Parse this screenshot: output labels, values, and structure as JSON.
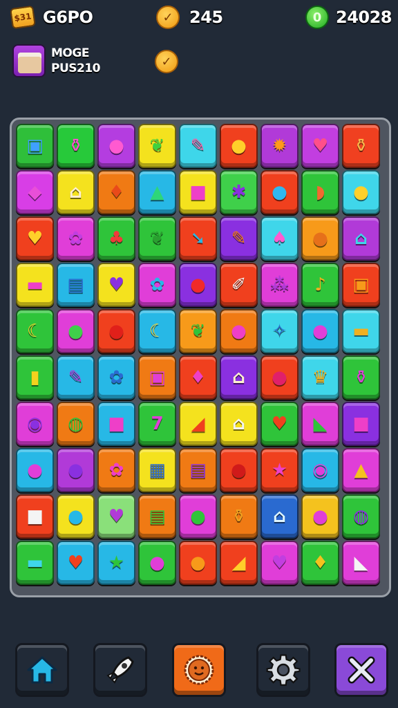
{
  "hud": {
    "level_badge": "$31",
    "title": "G6PO",
    "coins": "245",
    "gems": "24028",
    "profile_line1": "MOGE",
    "profile_line2": "PUS210",
    "coin_glyph": "✓"
  },
  "board": {
    "rows": 10,
    "cols": 9,
    "tiles": [
      [
        {
          "bg": "#2fbf3a",
          "icon": "tablet-icon",
          "g": "▣",
          "c": "#3fa0ff"
        },
        {
          "bg": "#27c93a",
          "icon": "bottle-icon",
          "g": "⚱",
          "c": "#ff4fd0"
        },
        {
          "bg": "#b43de0",
          "icon": "apple-icon",
          "g": "●",
          "c": "#ff5ad0"
        },
        {
          "bg": "#f4e21e",
          "icon": "leaf-icon",
          "g": "❦",
          "c": "#3fd03f"
        },
        {
          "bg": "#3ed6ea",
          "icon": "pencil-icon",
          "g": "✎",
          "c": "#ff5aa0"
        },
        {
          "bg": "#f0401e",
          "icon": "lemon-icon",
          "g": "●",
          "c": "#ffd02a"
        },
        {
          "bg": "#b13ad8",
          "icon": "sun-icon",
          "g": "✹",
          "c": "#ff9a1a"
        },
        {
          "bg": "#c23ee0",
          "icon": "heart-icon",
          "g": "♥",
          "c": "#ff4f8a"
        },
        {
          "bg": "#f04020",
          "icon": "jar-icon",
          "g": "⚱",
          "c": "#f6b64a"
        }
      ],
      [
        {
          "bg": "#d83ee6",
          "icon": "gem-icon",
          "g": "◆",
          "c": "#e94fd8"
        },
        {
          "bg": "#f4e21e",
          "icon": "cupcake-icon",
          "g": "⌂",
          "c": "#fff0d0"
        },
        {
          "bg": "#f07a14",
          "icon": "carrot-icon",
          "g": "♦",
          "c": "#e94a1a"
        },
        {
          "bg": "#27b8e6",
          "icon": "pear-icon",
          "g": "▲",
          "c": "#2ed67a"
        },
        {
          "bg": "#f4e21e",
          "icon": "box-icon",
          "g": "■",
          "c": "#ee3fc8"
        },
        {
          "bg": "#3fd04a",
          "icon": "star-icon",
          "g": "✱",
          "c": "#8a30e0"
        },
        {
          "bg": "#f0401e",
          "icon": "drop-icon",
          "g": "●",
          "c": "#2fb8f0"
        },
        {
          "bg": "#2fc43a",
          "icon": "watermelon-icon",
          "g": "◗",
          "c": "#f06a30"
        },
        {
          "bg": "#3fd6ea",
          "icon": "lemon-icon",
          "g": "●",
          "c": "#ffd02a"
        }
      ],
      [
        {
          "bg": "#f0401e",
          "icon": "heart-icon",
          "g": "♥",
          "c": "#ffd02a"
        },
        {
          "bg": "#e03ed8",
          "icon": "flower-icon",
          "g": "✿",
          "c": "#c23ee0"
        },
        {
          "bg": "#2fc43a",
          "icon": "berry-icon",
          "g": "♣",
          "c": "#f03a3a"
        },
        {
          "bg": "#2fc43a",
          "icon": "leaf-icon",
          "g": "❦",
          "c": "#2aa030"
        },
        {
          "bg": "#f0401e",
          "icon": "arrow-icon",
          "g": "➘",
          "c": "#27b8e6"
        },
        {
          "bg": "#8a30e0",
          "icon": "carrot-icon",
          "g": "✎",
          "c": "#f07a14"
        },
        {
          "bg": "#3fd6ea",
          "icon": "sock-icon",
          "g": "♠",
          "c": "#ff5ad0"
        },
        {
          "bg": "#f79a1a",
          "icon": "egg-icon",
          "g": "●",
          "c": "#e6701a"
        },
        {
          "bg": "#b13ad8",
          "icon": "cupcake-icon",
          "g": "⌂",
          "c": "#3fd6ea"
        }
      ],
      [
        {
          "bg": "#f4e21e",
          "icon": "cake-icon",
          "g": "▬",
          "c": "#ee3fc8"
        },
        {
          "bg": "#27b8e6",
          "icon": "radio-icon",
          "g": "▤",
          "c": "#2a6ad0"
        },
        {
          "bg": "#f4e21e",
          "icon": "eggplant-icon",
          "g": "♥",
          "c": "#8a30e0"
        },
        {
          "bg": "#e03ed8",
          "icon": "flower-icon",
          "g": "✿",
          "c": "#27b8e6"
        },
        {
          "bg": "#8a30e0",
          "icon": "apple-icon",
          "g": "●",
          "c": "#f02a2a"
        },
        {
          "bg": "#f0401e",
          "icon": "bottle-icon",
          "g": "✐",
          "c": "#f4f4f4"
        },
        {
          "bg": "#e03ed8",
          "icon": "grapes-icon",
          "g": "⁂",
          "c": "#b13ad8"
        },
        {
          "bg": "#2fc43a",
          "icon": "pepper-icon",
          "g": "♪",
          "c": "#f0b020"
        },
        {
          "bg": "#f0401e",
          "icon": "box-icon",
          "g": "▣",
          "c": "#f79a1a"
        }
      ],
      [
        {
          "bg": "#2fc43a",
          "icon": "banana-icon",
          "g": "☾",
          "c": "#ffd02a"
        },
        {
          "bg": "#e03ed8",
          "icon": "apple-icon",
          "g": "●",
          "c": "#3fd04a"
        },
        {
          "bg": "#f0401e",
          "icon": "apple-icon",
          "g": "●",
          "c": "#e0201a"
        },
        {
          "bg": "#27b8e6",
          "icon": "banana-icon",
          "g": "☾",
          "c": "#ffd02a"
        },
        {
          "bg": "#f79a1a",
          "icon": "leaf-icon",
          "g": "❦",
          "c": "#2fc43a"
        },
        {
          "bg": "#f07a14",
          "icon": "egg-icon",
          "g": "●",
          "c": "#ee3fc8"
        },
        {
          "bg": "#3fd6ea",
          "icon": "candy-icon",
          "g": "✧",
          "c": "#2a6ad0"
        },
        {
          "bg": "#27b8e6",
          "icon": "apple-icon",
          "g": "●",
          "c": "#e03ed8"
        },
        {
          "bg": "#3fd6ea",
          "icon": "cake-icon",
          "g": "▬",
          "c": "#f0b020"
        }
      ],
      [
        {
          "bg": "#2fc43a",
          "icon": "tube-icon",
          "g": "▮",
          "c": "#f4d21e"
        },
        {
          "bg": "#27b8e6",
          "icon": "pencil-icon",
          "g": "✎",
          "c": "#b13ad8"
        },
        {
          "bg": "#27b8e6",
          "icon": "flower-icon",
          "g": "✿",
          "c": "#2a6ad0"
        },
        {
          "bg": "#f07a14",
          "icon": "jar-icon",
          "g": "▣",
          "c": "#e03ed8"
        },
        {
          "bg": "#f0401e",
          "icon": "pepper-icon",
          "g": "♦",
          "c": "#ee3fc8"
        },
        {
          "bg": "#8a30e0",
          "icon": "cupcake-icon",
          "g": "⌂",
          "c": "#fff0d0"
        },
        {
          "bg": "#f0401e",
          "icon": "berry-icon",
          "g": "●",
          "c": "#e0206a"
        },
        {
          "bg": "#3fd6ea",
          "icon": "trophy-icon",
          "g": "♛",
          "c": "#f0b020"
        },
        {
          "bg": "#2fc43a",
          "icon": "bottle-icon",
          "g": "⚱",
          "c": "#e03ed8"
        }
      ],
      [
        {
          "bg": "#e03ed8",
          "icon": "donut-icon",
          "g": "◉",
          "c": "#8a30e0"
        },
        {
          "bg": "#f07a14",
          "icon": "speech-icon",
          "g": "◍",
          "c": "#2fc43a"
        },
        {
          "bg": "#27b8e6",
          "icon": "square-icon",
          "g": "■",
          "c": "#ee3fc8"
        },
        {
          "bg": "#2fc43a",
          "icon": "seven-icon",
          "g": "7",
          "c": "#e03ed8"
        },
        {
          "bg": "#f4e21e",
          "icon": "flag-icon",
          "g": "◢",
          "c": "#f0401e"
        },
        {
          "bg": "#f4e21e",
          "icon": "cupcake-icon",
          "g": "⌂",
          "c": "#f4f4f4"
        },
        {
          "bg": "#2fc43a",
          "icon": "apple-icon",
          "g": "♥",
          "c": "#f0401e"
        },
        {
          "bg": "#e03ed8",
          "icon": "cone-icon",
          "g": "◣",
          "c": "#2fc43a"
        },
        {
          "bg": "#8a30e0",
          "icon": "gift-icon",
          "g": "■",
          "c": "#ee3fc8"
        }
      ],
      [
        {
          "bg": "#27b8e6",
          "icon": "apple-icon",
          "g": "●",
          "c": "#e03ed8"
        },
        {
          "bg": "#b13ad8",
          "icon": "ball-icon",
          "g": "●",
          "c": "#8a30e0"
        },
        {
          "bg": "#f07a14",
          "icon": "flower-icon",
          "g": "✿",
          "c": "#ee3fc8"
        },
        {
          "bg": "#f4e21e",
          "icon": "radio-icon",
          "g": "▦",
          "c": "#2a6ad0"
        },
        {
          "bg": "#f07a14",
          "icon": "jar-icon",
          "g": "▤",
          "c": "#8a30e0"
        },
        {
          "bg": "#f0401e",
          "icon": "apple-icon",
          "g": "●",
          "c": "#d01a1a"
        },
        {
          "bg": "#f0401e",
          "icon": "star-icon",
          "g": "★",
          "c": "#ee3fc8"
        },
        {
          "bg": "#27b8e6",
          "icon": "cherry-icon",
          "g": "◉",
          "c": "#e03ed8"
        },
        {
          "bg": "#e03ed8",
          "icon": "bread-icon",
          "g": "▲",
          "c": "#f4c21e"
        }
      ],
      [
        {
          "bg": "#f0401e",
          "icon": "cube-icon",
          "g": "■",
          "c": "#f4f4f4"
        },
        {
          "bg": "#f4e21e",
          "icon": "drop-icon",
          "g": "●",
          "c": "#27b8e6"
        },
        {
          "bg": "#8ae07a",
          "icon": "heart-icon",
          "g": "♥",
          "c": "#b13ad8"
        },
        {
          "bg": "#f07a14",
          "icon": "battery-icon",
          "g": "▤",
          "c": "#2fc43a"
        },
        {
          "bg": "#e03ed8",
          "icon": "lime-icon",
          "g": "●",
          "c": "#2fc43a"
        },
        {
          "bg": "#f07a14",
          "icon": "jar-icon",
          "g": "⚱",
          "c": "#f0a020"
        },
        {
          "bg": "#2a6ad0",
          "icon": "cupcake-icon",
          "g": "⌂",
          "c": "#dff6ff"
        },
        {
          "bg": "#f4c21e",
          "icon": "plum-icon",
          "g": "●",
          "c": "#e03ed8"
        },
        {
          "bg": "#2fc43a",
          "icon": "bubble-icon",
          "g": "◍",
          "c": "#8a30e0"
        }
      ],
      [
        {
          "bg": "#2fc43a",
          "icon": "cake-icon",
          "g": "▬",
          "c": "#3fd6ea"
        },
        {
          "bg": "#27b8e6",
          "icon": "berry-icon",
          "g": "♥",
          "c": "#f0401e"
        },
        {
          "bg": "#27b8e6",
          "icon": "star-icon",
          "g": "★",
          "c": "#2fc43a"
        },
        {
          "bg": "#2fc43a",
          "icon": "apple-icon",
          "g": "●",
          "c": "#e03ed8"
        },
        {
          "bg": "#f0401e",
          "icon": "orange-icon",
          "g": "●",
          "c": "#f79a1a"
        },
        {
          "bg": "#f0401e",
          "icon": "cheese-icon",
          "g": "◢",
          "c": "#ffd02a"
        },
        {
          "bg": "#e03ed8",
          "icon": "heart-icon",
          "g": "♥",
          "c": "#c23ee0"
        },
        {
          "bg": "#2fc43a",
          "icon": "pear-icon",
          "g": "♦",
          "c": "#f4c21e"
        },
        {
          "bg": "#e03ed8",
          "icon": "boot-icon",
          "g": "◣",
          "c": "#f4f4f4"
        }
      ]
    ]
  },
  "nav": [
    {
      "name": "home-icon",
      "bg": "#4a5260"
    },
    {
      "name": "rocket-icon",
      "bg": "#4a5260"
    },
    {
      "name": "cookie-icon",
      "bg": "#f06a18"
    },
    {
      "name": "gear-icon",
      "bg": "#4a5260"
    },
    {
      "name": "close-icon",
      "bg": "#8a4ad8"
    }
  ]
}
